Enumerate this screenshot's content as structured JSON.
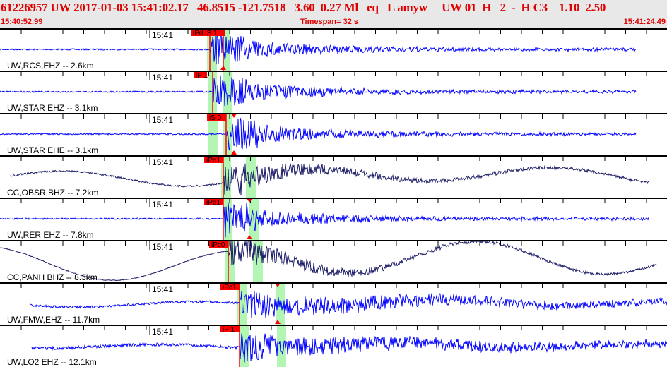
{
  "header": {
    "title": "61226957 UW 2017-01-03 15:41:02.17   46.8515 -121.7518   3.60  0.27 Ml   eq   L amyw     UW 01  H   2  -  H C3    1.10  2.50",
    "start_time": "15:40:52.99",
    "timespan": "Timespan=  32 s",
    "end_time": "15:41:24.49"
  },
  "colors": {
    "header_text": "#e00000",
    "trace_blue": "#0000ff",
    "trace_navy": "#1a1a66",
    "pick": "#ff0000",
    "window": "#b3f5b3"
  },
  "tick_label": "15:41",
  "channels": [
    {
      "label": "UW,RCS,EHZ -- 2.6km",
      "pick": "iPd iS 1",
      "color": "blue"
    },
    {
      "label": "UW,STAR EHZ -- 3.1km",
      "pick": "iP 1",
      "color": "blue"
    },
    {
      "label": "UW,STAR EHE -- 3.1km",
      "pick": "iS 0",
      "color": "blue"
    },
    {
      "label": "CC,OBSR BHZ -- 7.2km",
      "pick": "iPd1",
      "color": "navy"
    },
    {
      "label": "UW,RER EHZ -- 7.8km",
      "pick": "iPd1",
      "color": "blue"
    },
    {
      "label": "CC,PANH BHZ -- 8.3km",
      "pick": "iPc0",
      "color": "navy"
    },
    {
      "label": "UW,FMW,EHZ -- 11.7km",
      "pick": "iPc1",
      "color": "blue"
    },
    {
      "label": "UW,LO2 EHZ -- 12.1km",
      "pick": "iP 1",
      "color": "blue"
    }
  ]
}
